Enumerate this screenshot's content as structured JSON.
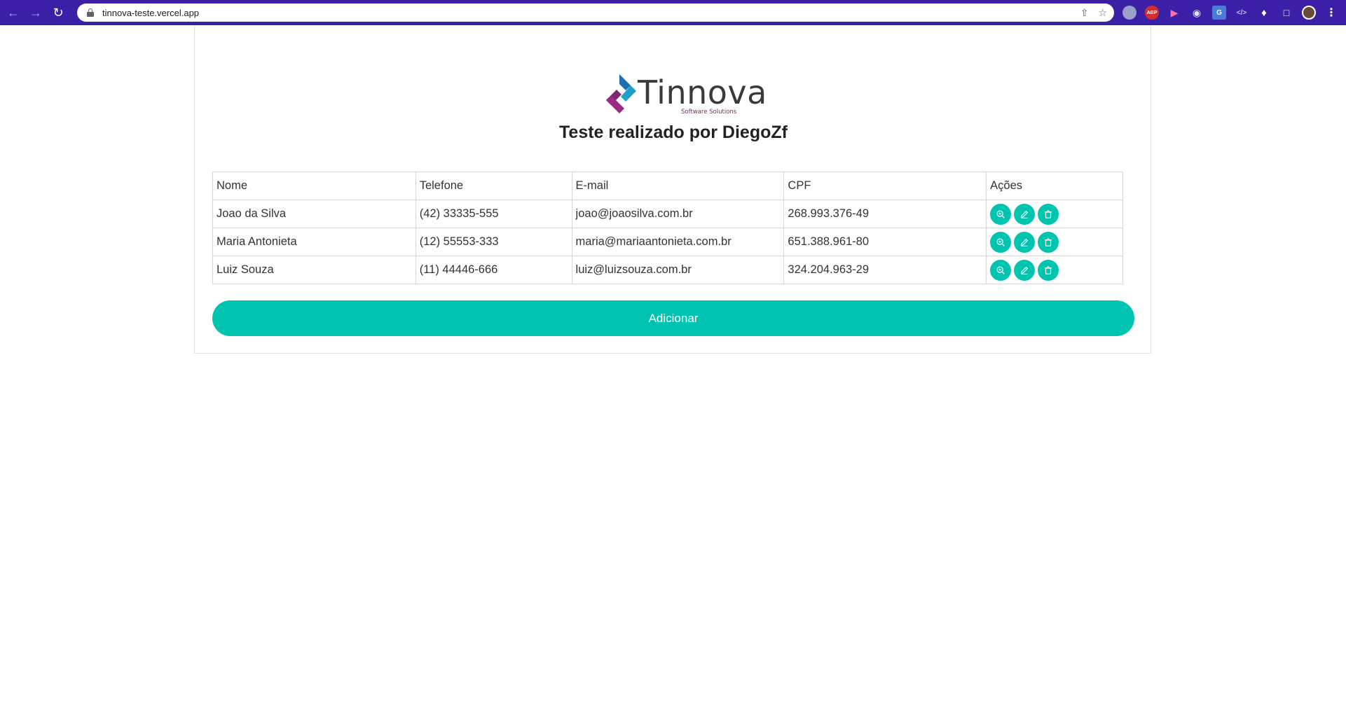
{
  "browser": {
    "url": "tinnova-teste.vercel.app",
    "back_icon": "arrow-left",
    "forward_icon": "arrow-right",
    "reload_icon": "reload",
    "extensions": [
      "privacy-badger-icon",
      "adblock-plus-icon",
      "video-icon",
      "camera-icon",
      "translate-icon",
      "code-icon",
      "puzzle-icon",
      "sidebar-icon",
      "avatar",
      "menu-icon"
    ],
    "abp_label": "ABP",
    "accent_color": "#3b1fa7"
  },
  "brand": {
    "name": "Tinnova",
    "tagline": "Software Solutions"
  },
  "page": {
    "title": "Teste realizado por DiegoZf"
  },
  "table": {
    "headers": {
      "nome": "Nome",
      "telefone": "Telefone",
      "email": "E-mail",
      "cpf": "CPF",
      "acoes": "Ações"
    },
    "rows": [
      {
        "nome": "Joao da Silva",
        "telefone": "(42) 33335-555",
        "email": "joao@joaosilva.com.br",
        "cpf": "268.993.376-49"
      },
      {
        "nome": "Maria Antonieta",
        "telefone": "(12) 55553-333",
        "email": "maria@mariaantonieta.com.br",
        "cpf": "651.388.961-80"
      },
      {
        "nome": "Luiz Souza",
        "telefone": "(11) 44446-666",
        "email": "luiz@luizsouza.com.br",
        "cpf": "324.204.963-29"
      }
    ],
    "row_actions": [
      "view-icon",
      "edit-icon",
      "delete-icon"
    ]
  },
  "actions": {
    "add_label": "Adicionar"
  },
  "colors": {
    "primary": "#00c4b0",
    "text": "#333333",
    "border": "#d7d7d7"
  }
}
